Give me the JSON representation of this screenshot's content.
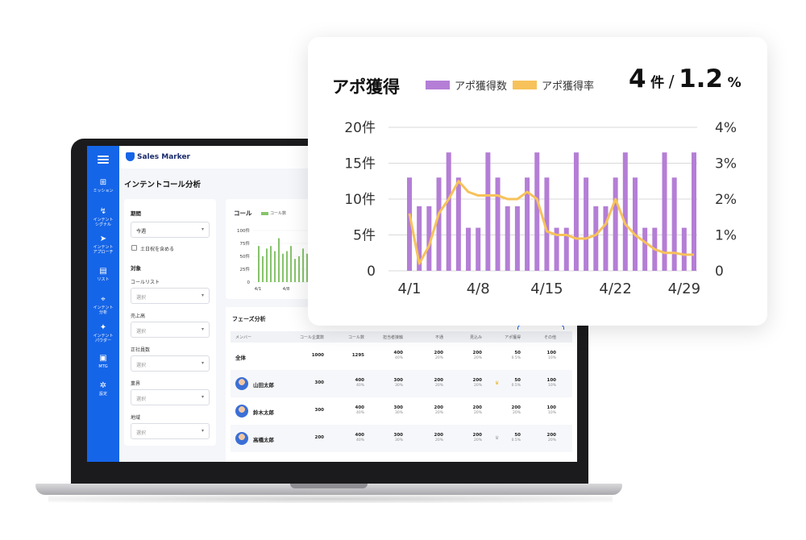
{
  "app": {
    "logo_text": "Sales Marker",
    "page_title": "インテントコール分析"
  },
  "sidebar": {
    "items": [
      {
        "icon": "mission-icon",
        "glyph": "⊞",
        "label": "ミッション"
      },
      {
        "icon": "intent-signal-icon",
        "glyph": "↯",
        "label": "インテント\nシグナル"
      },
      {
        "icon": "send-icon",
        "glyph": "➤",
        "label": "インテント\nアプローチ"
      },
      {
        "icon": "list-icon",
        "glyph": "▤",
        "label": "リスト"
      },
      {
        "icon": "analysis-icon",
        "glyph": "⌖",
        "label": "インテント\n分析"
      },
      {
        "icon": "sparkle-icon",
        "glyph": "✦",
        "label": "インテント\nパウダー"
      },
      {
        "icon": "video-icon",
        "glyph": "▣",
        "label": "MTG"
      },
      {
        "icon": "gear-icon",
        "glyph": "✲",
        "label": "設定"
      }
    ]
  },
  "filters": {
    "period_label": "期間",
    "period_value": "今週",
    "weekend_label": "土日祝を含める",
    "target_label": "対象",
    "fields": [
      {
        "label": "コールリスト",
        "placeholder": "選択"
      },
      {
        "label": "売上高",
        "placeholder": "選択"
      },
      {
        "label": "正社員数",
        "placeholder": "選択"
      },
      {
        "label": "業界",
        "placeholder": "選択"
      },
      {
        "label": "地域",
        "placeholder": "選択"
      }
    ]
  },
  "call_panel": {
    "title": "コール",
    "legend": "コール数"
  },
  "phase": {
    "title": "フェーズ分析",
    "headers": [
      "メンバー",
      "コール企業数",
      "コール数",
      "担当者接触",
      "不通",
      "見込み",
      "アポ獲得",
      "その他"
    ],
    "rows": [
      {
        "name": "全体",
        "cells": [
          [
            "1000",
            ""
          ],
          [
            "1295",
            ""
          ],
          [
            "400",
            "40%"
          ],
          [
            "200",
            "20%"
          ],
          [
            "200",
            "20%"
          ],
          [
            "50",
            "0.5%"
          ],
          [
            "100",
            "10%"
          ]
        ]
      },
      {
        "name": "山田太郎",
        "cells": [
          [
            "300",
            ""
          ],
          [
            "400",
            "40%"
          ],
          [
            "300",
            "30%"
          ],
          [
            "200",
            "20%"
          ],
          [
            "200",
            "20%"
          ],
          [
            "50",
            "0.5%"
          ],
          [
            "100",
            "10%"
          ]
        ]
      },
      {
        "name": "鈴木太郎",
        "cells": [
          [
            "300",
            ""
          ],
          [
            "400",
            "40%"
          ],
          [
            "300",
            "30%"
          ],
          [
            "200",
            "20%"
          ],
          [
            "200",
            "20%"
          ],
          [
            "200",
            "20%"
          ],
          [
            "100",
            "10%"
          ]
        ]
      },
      {
        "name": "高橋太郎",
        "cells": [
          [
            "200",
            ""
          ],
          [
            "400",
            "40%"
          ],
          [
            "300",
            "30%"
          ],
          [
            "200",
            "20%"
          ],
          [
            "200",
            "20%"
          ],
          [
            "50",
            "0.5%"
          ],
          [
            "200",
            "20%"
          ]
        ]
      }
    ]
  },
  "card": {
    "title": "アポ獲得",
    "legend_count": "アポ獲得数",
    "legend_rate": "アポ獲得率",
    "kpi_count": "4",
    "kpi_count_unit": "件",
    "kpi_slash": "/",
    "kpi_rate": "1.2",
    "kpi_rate_unit": "%"
  },
  "colors": {
    "brand": "#1565e8",
    "bar": "#b47ed6",
    "line": "#f7c25a",
    "call_bar": "#86c36b"
  },
  "chart_data": [
    {
      "type": "bar+line",
      "title": "アポ獲得",
      "x": [
        "4/1",
        "4/2",
        "4/3",
        "4/4",
        "4/5",
        "4/6",
        "4/7",
        "4/8",
        "4/9",
        "4/10",
        "4/11",
        "4/12",
        "4/13",
        "4/14",
        "4/15",
        "4/16",
        "4/17",
        "4/18",
        "4/19",
        "4/20",
        "4/21",
        "4/22",
        "4/23",
        "4/24",
        "4/25",
        "4/26",
        "4/27",
        "4/28",
        "4/29",
        "4/30"
      ],
      "x_ticks": [
        "4/1",
        "4/8",
        "4/15",
        "4/22",
        "4/29"
      ],
      "series": [
        {
          "name": "アポ獲得数",
          "axis": "left",
          "values": [
            13,
            9,
            9,
            13,
            16.5,
            13,
            6,
            6,
            16.5,
            13,
            9,
            9,
            13,
            16.5,
            13,
            6,
            6,
            16.5,
            13,
            9,
            9,
            13,
            16.5,
            13,
            6,
            6,
            16.5,
            13,
            6,
            16.5
          ]
        },
        {
          "name": "アポ獲得率",
          "axis": "right",
          "values": [
            1.6,
            0.2,
            0.7,
            1.6,
            2.0,
            2.5,
            2.2,
            2.1,
            2.1,
            2.1,
            2.0,
            2.0,
            2.2,
            2.0,
            1.1,
            1.0,
            1.0,
            0.9,
            0.9,
            1.0,
            1.3,
            2.0,
            1.3,
            1.0,
            0.8,
            0.6,
            0.5,
            0.5,
            0.45,
            0.45
          ]
        }
      ],
      "yleft": {
        "ticks": [
          "0",
          "5件",
          "10件",
          "15件",
          "20件"
        ],
        "lim": [
          0,
          20
        ]
      },
      "yright": {
        "ticks": [
          "0",
          "1%",
          "2%",
          "3%",
          "4%"
        ],
        "lim": [
          0,
          4
        ]
      },
      "grid": true
    },
    {
      "type": "bar",
      "title": "コール",
      "yticks": [
        "0",
        "25件",
        "50件",
        "75件",
        "100件"
      ],
      "ylim": [
        0,
        100
      ],
      "x_ticks": [
        "4/1",
        "4/8"
      ],
      "values": [
        70,
        50,
        65,
        70,
        60,
        85,
        55,
        60,
        70,
        45,
        50,
        65,
        55,
        40
      ]
    }
  ]
}
